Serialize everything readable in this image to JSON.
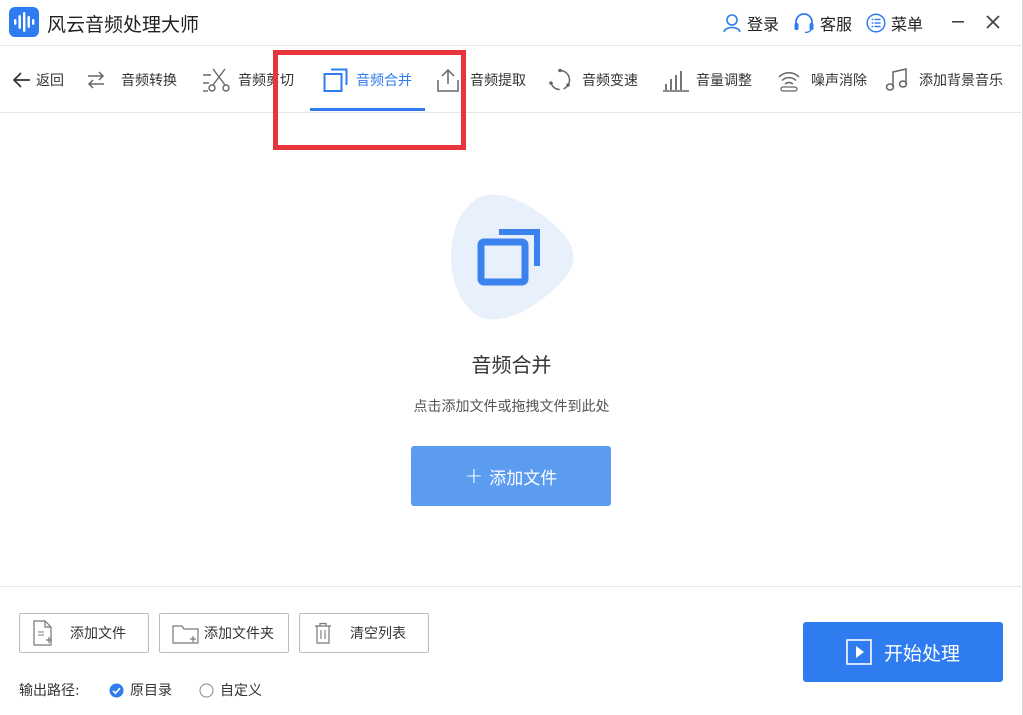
{
  "app": {
    "title": "风云音频处理大师"
  },
  "header": {
    "login_label": "登录",
    "service_label": "客服",
    "menu_label": "菜单"
  },
  "nav": {
    "back_label": "返回",
    "items": [
      {
        "label": "音频转换",
        "icon": "convert-icon"
      },
      {
        "label": "音频剪切",
        "icon": "scissors-icon"
      },
      {
        "label": "音频合并",
        "icon": "merge-icon",
        "active": true
      },
      {
        "label": "音频提取",
        "icon": "extract-icon"
      },
      {
        "label": "音频变速",
        "icon": "speed-icon"
      },
      {
        "label": "音量调整",
        "icon": "volume-icon"
      },
      {
        "label": "噪声消除",
        "icon": "noise-icon"
      },
      {
        "label": "添加背景音乐",
        "icon": "music-note-icon"
      }
    ]
  },
  "main": {
    "title": "音频合并",
    "hint": "点击添加文件或拖拽文件到此处",
    "add_file_label": "添加文件",
    "add_file_plus": "+"
  },
  "bottom": {
    "add_file_label": "添加文件",
    "add_folder_label": "添加文件夹",
    "clear_list_label": "清空列表",
    "start_label": "开始处理",
    "output_path_label": "输出路径:",
    "option_original": "原目录",
    "option_custom": "自定义",
    "selected_option": "原目录"
  },
  "colors": {
    "accent": "#2f7cf0",
    "add_button": "#5b9cf0",
    "highlight": "#e8353b",
    "hero_bg": "#e8f0fb"
  }
}
